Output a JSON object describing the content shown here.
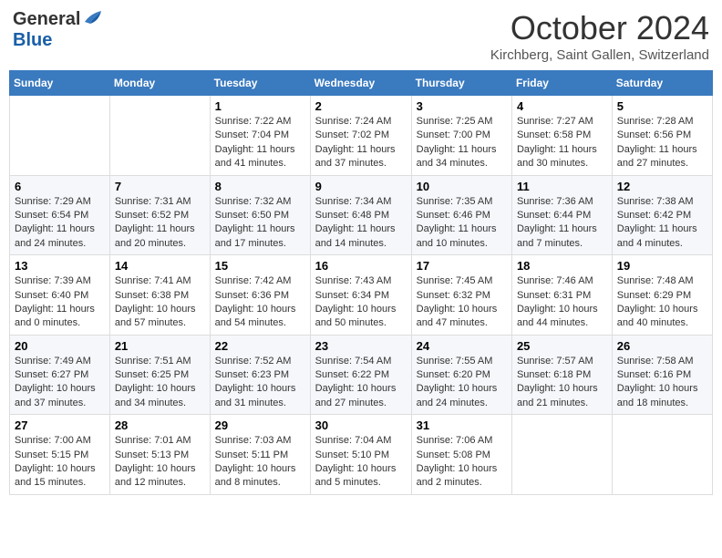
{
  "header": {
    "logo_general": "General",
    "logo_blue": "Blue",
    "month": "October 2024",
    "location": "Kirchberg, Saint Gallen, Switzerland"
  },
  "weekdays": [
    "Sunday",
    "Monday",
    "Tuesday",
    "Wednesday",
    "Thursday",
    "Friday",
    "Saturday"
  ],
  "weeks": [
    [
      {
        "day": "",
        "info": ""
      },
      {
        "day": "",
        "info": ""
      },
      {
        "day": "1",
        "info": "Sunrise: 7:22 AM\nSunset: 7:04 PM\nDaylight: 11 hours and 41 minutes."
      },
      {
        "day": "2",
        "info": "Sunrise: 7:24 AM\nSunset: 7:02 PM\nDaylight: 11 hours and 37 minutes."
      },
      {
        "day": "3",
        "info": "Sunrise: 7:25 AM\nSunset: 7:00 PM\nDaylight: 11 hours and 34 minutes."
      },
      {
        "day": "4",
        "info": "Sunrise: 7:27 AM\nSunset: 6:58 PM\nDaylight: 11 hours and 30 minutes."
      },
      {
        "day": "5",
        "info": "Sunrise: 7:28 AM\nSunset: 6:56 PM\nDaylight: 11 hours and 27 minutes."
      }
    ],
    [
      {
        "day": "6",
        "info": "Sunrise: 7:29 AM\nSunset: 6:54 PM\nDaylight: 11 hours and 24 minutes."
      },
      {
        "day": "7",
        "info": "Sunrise: 7:31 AM\nSunset: 6:52 PM\nDaylight: 11 hours and 20 minutes."
      },
      {
        "day": "8",
        "info": "Sunrise: 7:32 AM\nSunset: 6:50 PM\nDaylight: 11 hours and 17 minutes."
      },
      {
        "day": "9",
        "info": "Sunrise: 7:34 AM\nSunset: 6:48 PM\nDaylight: 11 hours and 14 minutes."
      },
      {
        "day": "10",
        "info": "Sunrise: 7:35 AM\nSunset: 6:46 PM\nDaylight: 11 hours and 10 minutes."
      },
      {
        "day": "11",
        "info": "Sunrise: 7:36 AM\nSunset: 6:44 PM\nDaylight: 11 hours and 7 minutes."
      },
      {
        "day": "12",
        "info": "Sunrise: 7:38 AM\nSunset: 6:42 PM\nDaylight: 11 hours and 4 minutes."
      }
    ],
    [
      {
        "day": "13",
        "info": "Sunrise: 7:39 AM\nSunset: 6:40 PM\nDaylight: 11 hours and 0 minutes."
      },
      {
        "day": "14",
        "info": "Sunrise: 7:41 AM\nSunset: 6:38 PM\nDaylight: 10 hours and 57 minutes."
      },
      {
        "day": "15",
        "info": "Sunrise: 7:42 AM\nSunset: 6:36 PM\nDaylight: 10 hours and 54 minutes."
      },
      {
        "day": "16",
        "info": "Sunrise: 7:43 AM\nSunset: 6:34 PM\nDaylight: 10 hours and 50 minutes."
      },
      {
        "day": "17",
        "info": "Sunrise: 7:45 AM\nSunset: 6:32 PM\nDaylight: 10 hours and 47 minutes."
      },
      {
        "day": "18",
        "info": "Sunrise: 7:46 AM\nSunset: 6:31 PM\nDaylight: 10 hours and 44 minutes."
      },
      {
        "day": "19",
        "info": "Sunrise: 7:48 AM\nSunset: 6:29 PM\nDaylight: 10 hours and 40 minutes."
      }
    ],
    [
      {
        "day": "20",
        "info": "Sunrise: 7:49 AM\nSunset: 6:27 PM\nDaylight: 10 hours and 37 minutes."
      },
      {
        "day": "21",
        "info": "Sunrise: 7:51 AM\nSunset: 6:25 PM\nDaylight: 10 hours and 34 minutes."
      },
      {
        "day": "22",
        "info": "Sunrise: 7:52 AM\nSunset: 6:23 PM\nDaylight: 10 hours and 31 minutes."
      },
      {
        "day": "23",
        "info": "Sunrise: 7:54 AM\nSunset: 6:22 PM\nDaylight: 10 hours and 27 minutes."
      },
      {
        "day": "24",
        "info": "Sunrise: 7:55 AM\nSunset: 6:20 PM\nDaylight: 10 hours and 24 minutes."
      },
      {
        "day": "25",
        "info": "Sunrise: 7:57 AM\nSunset: 6:18 PM\nDaylight: 10 hours and 21 minutes."
      },
      {
        "day": "26",
        "info": "Sunrise: 7:58 AM\nSunset: 6:16 PM\nDaylight: 10 hours and 18 minutes."
      }
    ],
    [
      {
        "day": "27",
        "info": "Sunrise: 7:00 AM\nSunset: 5:15 PM\nDaylight: 10 hours and 15 minutes."
      },
      {
        "day": "28",
        "info": "Sunrise: 7:01 AM\nSunset: 5:13 PM\nDaylight: 10 hours and 12 minutes."
      },
      {
        "day": "29",
        "info": "Sunrise: 7:03 AM\nSunset: 5:11 PM\nDaylight: 10 hours and 8 minutes."
      },
      {
        "day": "30",
        "info": "Sunrise: 7:04 AM\nSunset: 5:10 PM\nDaylight: 10 hours and 5 minutes."
      },
      {
        "day": "31",
        "info": "Sunrise: 7:06 AM\nSunset: 5:08 PM\nDaylight: 10 hours and 2 minutes."
      },
      {
        "day": "",
        "info": ""
      },
      {
        "day": "",
        "info": ""
      }
    ]
  ]
}
